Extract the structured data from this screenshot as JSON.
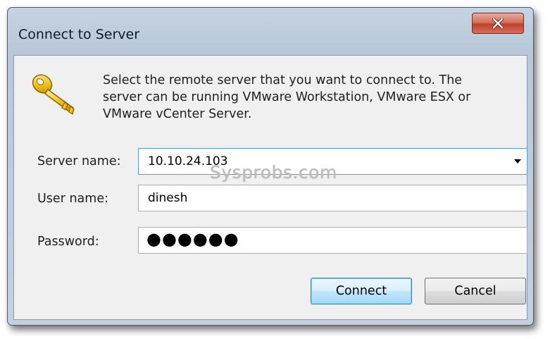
{
  "window": {
    "title": "Connect to Server",
    "close_icon": "close-x-icon"
  },
  "dialog": {
    "icon": "key-icon",
    "description_lines": [
      "Select the remote server that you want to connect to. The",
      "server can be running VMware Workstation, VMware ESX or",
      "VMware vCenter Server."
    ],
    "server": {
      "label": "Server name:",
      "value": "10.10.24.103"
    },
    "user": {
      "label": "User name:",
      "value": "dinesh"
    },
    "password": {
      "label": "Password:",
      "masked_value": "●●●●●●"
    },
    "watermark": "Sysprobs.com",
    "connect_label": "Connect",
    "cancel_label": "Cancel"
  },
  "colors": {
    "client_bg": "#f0f0f0",
    "frame_bg": "#c6d3e2",
    "close_red": "#c0412c",
    "focus_blue": "#5a9bd8"
  }
}
